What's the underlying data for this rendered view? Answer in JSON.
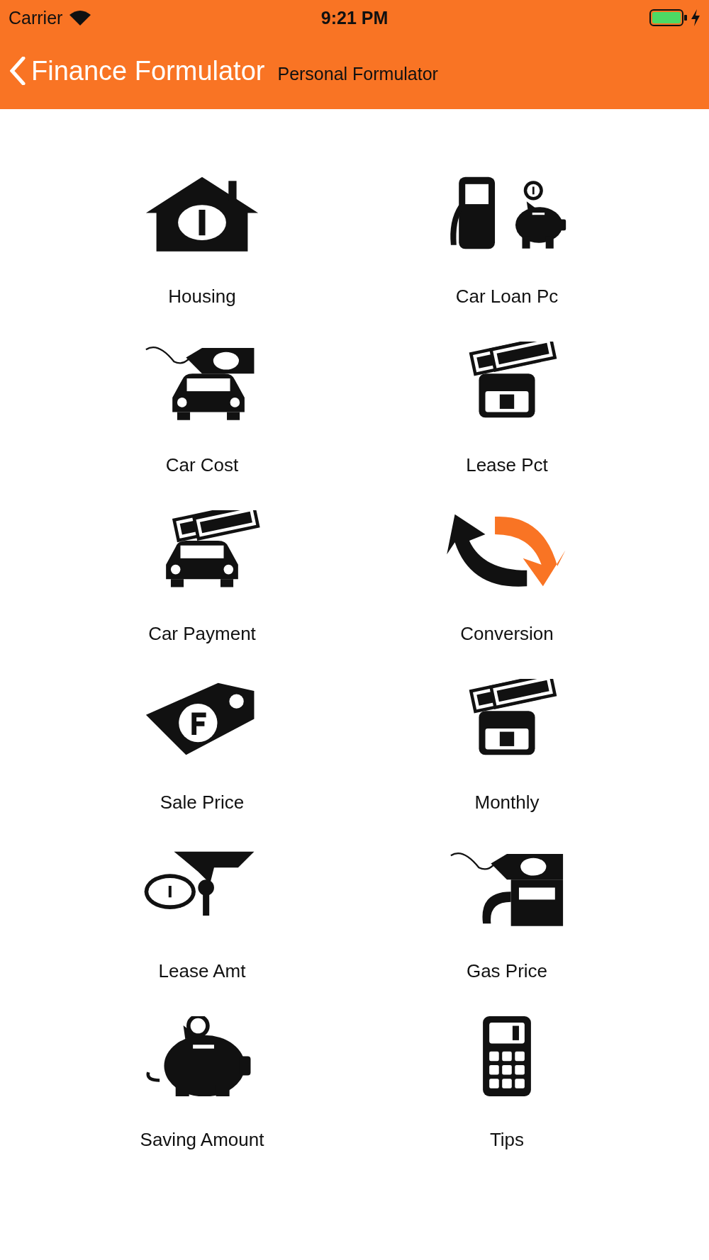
{
  "status_bar": {
    "carrier": "Carrier",
    "time": "9:21 PM"
  },
  "nav_bar": {
    "back_label": "Finance Formulator",
    "title": "Personal Formulator"
  },
  "items": [
    {
      "label": "Housing"
    },
    {
      "label": "Car Loan Pc"
    },
    {
      "label": "Car Cost"
    },
    {
      "label": "Lease Pct"
    },
    {
      "label": "Car Payment"
    },
    {
      "label": "Conversion"
    },
    {
      "label": "Sale Price"
    },
    {
      "label": "Monthly"
    },
    {
      "label": "Lease Amt"
    },
    {
      "label": "Gas Price"
    },
    {
      "label": "Saving Amount"
    },
    {
      "label": "Tips"
    }
  ]
}
